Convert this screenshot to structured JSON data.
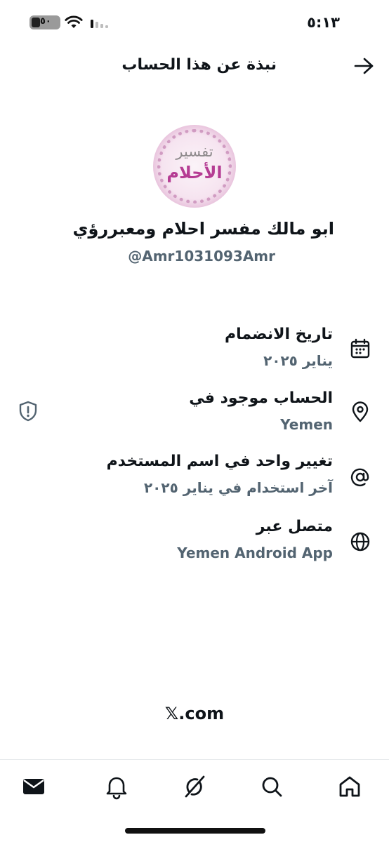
{
  "status_bar": {
    "time": "٥:١٣",
    "battery_label": "٥٠"
  },
  "header": {
    "title": "نبذة عن هذا الحساب",
    "back_icon": "arrow-right-icon"
  },
  "profile": {
    "avatar_text_line1": "تفسير",
    "avatar_text_line2": "الأحلام",
    "display_name": "ابو مالك مفسر احلام ومعبررؤي",
    "handle": "@Amr1031093Amr"
  },
  "info": [
    {
      "icon": "calendar-icon",
      "title": "تاريخ الانضمام",
      "value": "يناير ٢٠٢٥"
    },
    {
      "icon": "location-pin-icon",
      "title": "الحساب موجود في",
      "value": "Yemen"
    },
    {
      "icon": "at-sign-icon",
      "title": "تغيير واحد في اسم المستخدم",
      "value": "آخر استخدام في يناير ٢٠٢٥"
    },
    {
      "icon": "globe-icon",
      "title": "متصل عبر",
      "value": "Yemen Android App"
    }
  ],
  "footer": {
    "site": "𝕏.com"
  },
  "bottom_nav": [
    {
      "name": "messages",
      "icon": "envelope-icon"
    },
    {
      "name": "notifications",
      "icon": "bell-icon"
    },
    {
      "name": "grok",
      "icon": "grok-icon"
    },
    {
      "name": "search",
      "icon": "search-icon"
    },
    {
      "name": "home",
      "icon": "home-icon"
    }
  ],
  "colors": {
    "text_primary": "#0f1419",
    "text_secondary": "#536471",
    "avatar_accent": "#b53c93"
  }
}
